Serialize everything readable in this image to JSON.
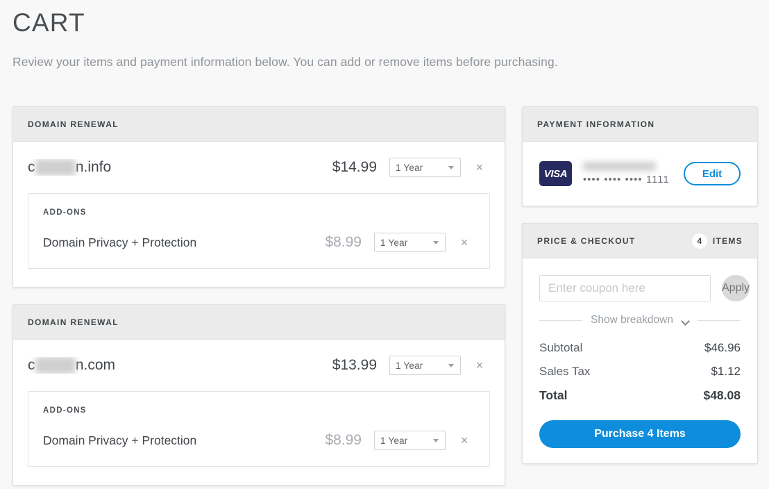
{
  "header": {
    "title": "CART",
    "subtitle": "Review your items and payment information below. You can add or remove items before purchasing."
  },
  "colors": {
    "accent_blue": "#0d8ddb",
    "visa_navy": "#262a5e",
    "panel_header_gray": "#ebebeb",
    "page_background": "#f8f8f8",
    "text_dark": "#41464b",
    "text_muted": "#9aa0a6"
  },
  "cart_items": [
    {
      "section_label": "DOMAIN RENEWAL",
      "name_prefix": "c",
      "name_redacted": "          ",
      "name_suffix": "n.info",
      "price": "$14.99",
      "term": "1 Year",
      "remove_icon": "×",
      "addons_label": "ADD-ONS",
      "addons": [
        {
          "name": "Domain Privacy + Protection",
          "price": "$8.99",
          "term": "1 Year",
          "remove_icon": "×"
        }
      ]
    },
    {
      "section_label": "DOMAIN RENEWAL",
      "name_prefix": "c",
      "name_redacted": "          ",
      "name_suffix": "n.com",
      "price": "$13.99",
      "term": "1 Year",
      "remove_icon": "×",
      "addons_label": "ADD-ONS",
      "addons": [
        {
          "name": "Domain Privacy + Protection",
          "price": "$8.99",
          "term": "1 Year",
          "remove_icon": "×"
        }
      ]
    }
  ],
  "payment": {
    "section_label": "PAYMENT INFORMATION",
    "card_brand": "VISA",
    "card_number_masked": "•••• •••• •••• 1111",
    "edit_label": "Edit"
  },
  "checkout": {
    "section_label": "PRICE & CHECKOUT",
    "items_count": "4",
    "items_word": "ITEMS",
    "coupon_placeholder": "Enter coupon here",
    "coupon_value": "",
    "apply_label": "Apply",
    "breakdown_label": "Show breakdown",
    "totals": [
      {
        "label": "Subtotal",
        "value": "$46.96"
      },
      {
        "label": "Sales Tax",
        "value": "$1.12"
      }
    ],
    "grand_total": {
      "label": "Total",
      "value": "$48.08"
    },
    "purchase_label": "Purchase 4 Items"
  }
}
